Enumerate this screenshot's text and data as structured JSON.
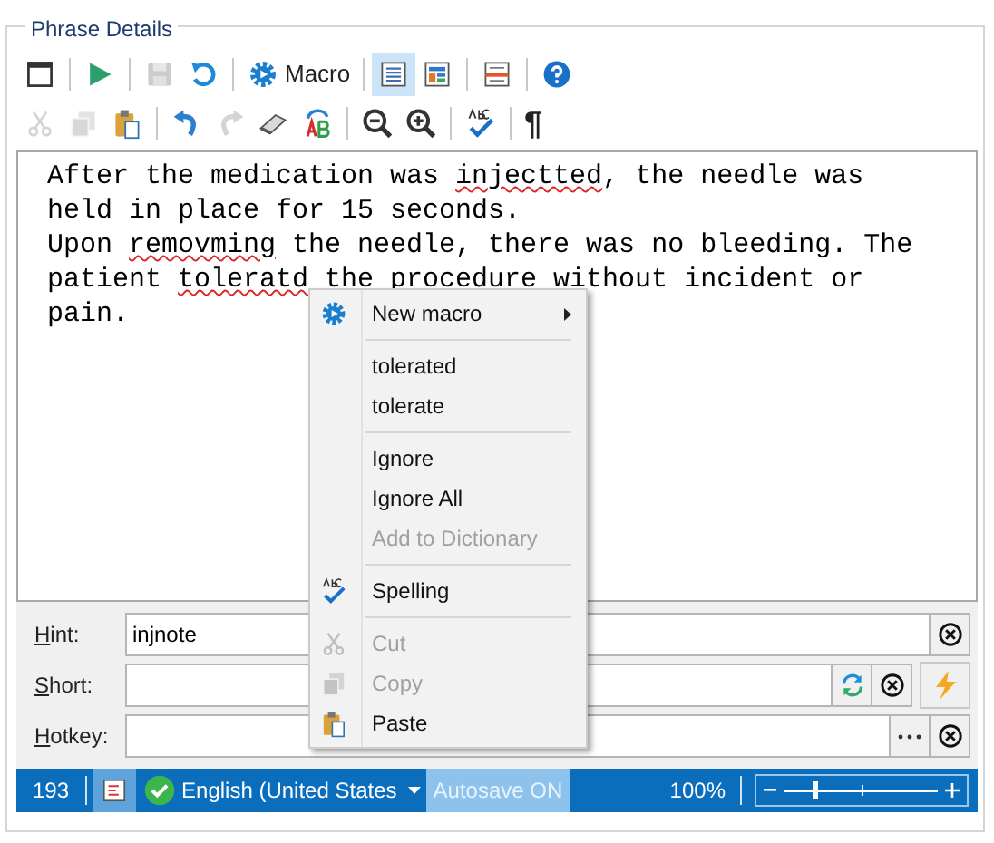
{
  "group_title": "Phrase Details",
  "toolbar_rows": [
    [
      {
        "kind": "fullscreen",
        "disabled": false,
        "selected": false
      },
      {
        "kind": "sep"
      },
      {
        "kind": "play",
        "disabled": false,
        "selected": false
      },
      {
        "kind": "sep"
      },
      {
        "kind": "save",
        "disabled": true,
        "selected": false
      },
      {
        "kind": "revert",
        "disabled": false,
        "selected": false
      },
      {
        "kind": "sep"
      },
      {
        "kind": "macro",
        "label": "Macro",
        "disabled": false,
        "selected": false
      },
      {
        "kind": "sep"
      },
      {
        "kind": "view_text",
        "disabled": false,
        "selected": true
      },
      {
        "kind": "view_form",
        "disabled": false,
        "selected": false
      },
      {
        "kind": "sep"
      },
      {
        "kind": "panel",
        "disabled": false,
        "selected": false
      },
      {
        "kind": "sep"
      },
      {
        "kind": "help",
        "disabled": false,
        "selected": false
      }
    ],
    [
      {
        "kind": "cut",
        "disabled": true,
        "selected": false
      },
      {
        "kind": "copy",
        "disabled": true,
        "selected": false
      },
      {
        "kind": "paste",
        "disabled": false,
        "selected": false
      },
      {
        "kind": "sep"
      },
      {
        "kind": "undo",
        "disabled": false,
        "selected": false
      },
      {
        "kind": "redo",
        "disabled": true,
        "selected": false
      },
      {
        "kind": "erase",
        "disabled": false,
        "selected": false
      },
      {
        "kind": "replace",
        "disabled": false,
        "selected": false
      },
      {
        "kind": "sep"
      },
      {
        "kind": "zoom_out",
        "disabled": false,
        "selected": false
      },
      {
        "kind": "zoom_in",
        "disabled": false,
        "selected": false
      },
      {
        "kind": "sep"
      },
      {
        "kind": "spell",
        "disabled": false,
        "selected": false
      },
      {
        "kind": "sep"
      },
      {
        "kind": "pilcrow",
        "label": "¶",
        "disabled": false,
        "selected": false
      }
    ]
  ],
  "editor_lines": [
    [
      {
        "text": "After the medication was "
      },
      {
        "text": "injectted",
        "misspelled": true
      },
      {
        "text": ", the needle was"
      }
    ],
    [
      {
        "text": "held in place for 15 seconds."
      }
    ],
    [
      {
        "text": "Upon "
      },
      {
        "text": "removming",
        "misspelled": true
      },
      {
        "text": " the needle, there was no bleeding. The"
      }
    ],
    [
      {
        "text": "patient "
      },
      {
        "text": "toleratd",
        "misspelled": true
      },
      {
        "text": " the procedure without incident or"
      }
    ],
    [
      {
        "text": "pain."
      }
    ]
  ],
  "context_menu": [
    [
      {
        "kind": "macro",
        "label": "New macro",
        "submenu": true,
        "disabled": false
      }
    ],
    [
      {
        "label": "tolerated",
        "disabled": false
      },
      {
        "label": "tolerate",
        "disabled": false
      }
    ],
    [
      {
        "label": "Ignore",
        "disabled": false
      },
      {
        "label": "Ignore All",
        "disabled": false
      },
      {
        "label": "Add to Dictionary",
        "disabled": true
      }
    ],
    [
      {
        "kind": "spell",
        "label": "Spelling",
        "disabled": false
      }
    ],
    [
      {
        "kind": "cut",
        "label": "Cut",
        "disabled": true
      },
      {
        "kind": "copy",
        "label": "Copy",
        "disabled": true
      },
      {
        "kind": "paste",
        "label": "Paste",
        "disabled": false
      }
    ]
  ],
  "fields": [
    {
      "label": "Hint:",
      "value": "injnote",
      "buttons": [
        {
          "kind": "clear"
        }
      ]
    },
    {
      "label": "Short:",
      "buttons": [
        {
          "kind": "refresh"
        },
        {
          "kind": "clear"
        },
        {
          "kind": "action"
        }
      ]
    },
    {
      "label": "Hotkey:",
      "buttons": [
        {
          "kind": "browse"
        },
        {
          "kind": "clear"
        }
      ]
    }
  ],
  "status_bar": {
    "count": "193",
    "language": "English (United States",
    "autosave": {
      "label": "Autosave ON",
      "on": true
    },
    "zoom": "100%",
    "zoom_slider": {
      "level": 0.2
    }
  }
}
